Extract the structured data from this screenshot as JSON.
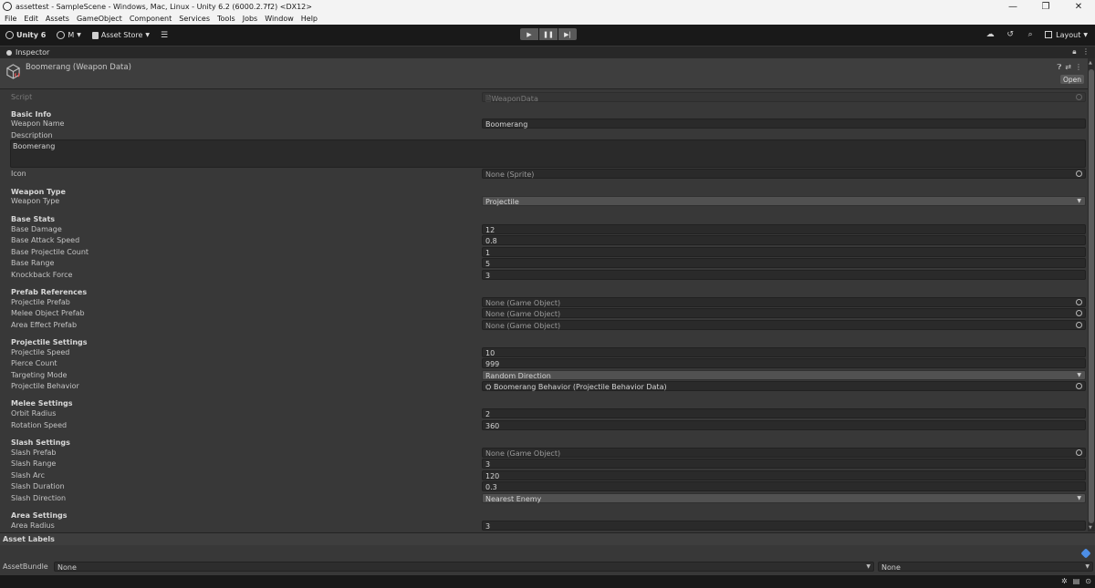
{
  "window": {
    "title": "assettest - SampleScene - Windows, Mac, Linux - Unity 6.2 (6000.2.7f2) <DX12>",
    "controls": [
      "—",
      "❐",
      "✕"
    ]
  },
  "menu": [
    "File",
    "Edit",
    "Assets",
    "GameObject",
    "Component",
    "Services",
    "Tools",
    "Jobs",
    "Window",
    "Help"
  ],
  "toolbar": {
    "unity_label": "Unity 6",
    "account_label": "M",
    "asset_store_label": "Asset Store",
    "layout_label": "Layout"
  },
  "inspector_tab": {
    "label": "Inspector"
  },
  "header": {
    "title": "Boomerang (Weapon Data)",
    "open_label": "Open"
  },
  "script": {
    "label": "Script",
    "value": "WeaponData"
  },
  "sections": {
    "basic_info": "Basic Info",
    "weapon_type": "Weapon Type",
    "base_stats": "Base Stats",
    "prefab_refs": "Prefab References",
    "projectile_settings": "Projectile Settings",
    "melee_settings": "Melee Settings",
    "slash_settings": "Slash Settings",
    "area_settings": "Area Settings"
  },
  "fields": {
    "weapon_name": {
      "label": "Weapon Name",
      "value": "Boomerang"
    },
    "description": {
      "label": "Description",
      "value": "Boomerang"
    },
    "icon": {
      "label": "Icon",
      "value": "None (Sprite)"
    },
    "weapon_type": {
      "label": "Weapon Type",
      "value": "Projectile"
    },
    "base_damage": {
      "label": "Base Damage",
      "value": "12"
    },
    "base_attack_speed": {
      "label": "Base Attack Speed",
      "value": "0.8"
    },
    "base_projectile_count": {
      "label": "Base Projectile Count",
      "value": "1"
    },
    "base_range": {
      "label": "Base Range",
      "value": "5"
    },
    "knockback_force": {
      "label": "Knockback Force",
      "value": "3"
    },
    "projectile_prefab": {
      "label": "Projectile Prefab",
      "value": "None (Game Object)"
    },
    "melee_object_prefab": {
      "label": "Melee Object Prefab",
      "value": "None (Game Object)"
    },
    "area_effect_prefab": {
      "label": "Area Effect Prefab",
      "value": "None (Game Object)"
    },
    "projectile_speed": {
      "label": "Projectile Speed",
      "value": "10"
    },
    "pierce_count": {
      "label": "Pierce Count",
      "value": "999"
    },
    "targeting_mode": {
      "label": "Targeting Mode",
      "value": "Random Direction"
    },
    "projectile_behavior": {
      "label": "Projectile Behavior",
      "value": "Boomerang Behavior (Projectile Behavior Data)"
    },
    "orbit_radius": {
      "label": "Orbit Radius",
      "value": "2"
    },
    "rotation_speed": {
      "label": "Rotation Speed",
      "value": "360"
    },
    "slash_prefab": {
      "label": "Slash Prefab",
      "value": "None (Game Object)"
    },
    "slash_range": {
      "label": "Slash Range",
      "value": "3"
    },
    "slash_arc": {
      "label": "Slash Arc",
      "value": "120"
    },
    "slash_duration": {
      "label": "Slash Duration",
      "value": "0.3"
    },
    "slash_direction": {
      "label": "Slash Direction",
      "value": "Nearest Enemy"
    },
    "area_radius": {
      "label": "Area Radius",
      "value": "3"
    }
  },
  "asset_labels": {
    "title": "Asset Labels",
    "bundle_label": "AssetBundle",
    "bundle_value": "None",
    "variant_value": "None"
  }
}
